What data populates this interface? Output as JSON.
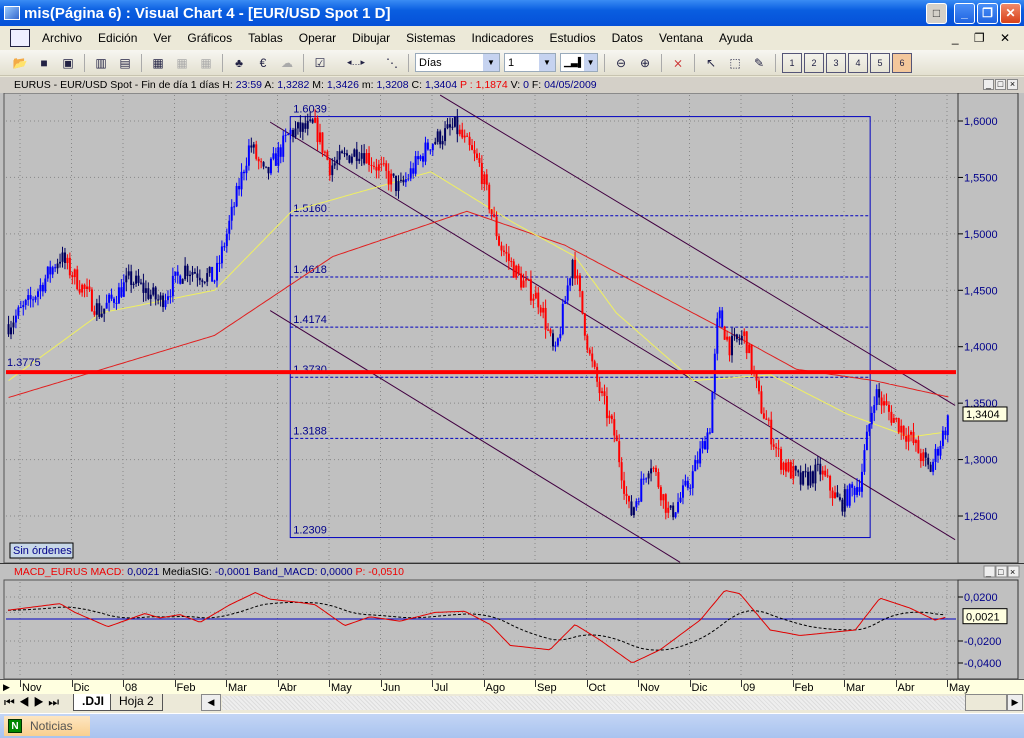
{
  "window": {
    "title": "mis(Página 6) : Visual Chart 4 - [EUR/USD Spot 1 D]"
  },
  "menu": [
    "Archivo",
    "Edición",
    "Ver",
    "Gráficos",
    "Tablas",
    "Operar",
    "Dibujar",
    "Sistemas",
    "Indicadores",
    "Estudios",
    "Datos",
    "Ventana",
    "Ayuda"
  ],
  "toolbar": {
    "period": "Días",
    "compression": "1",
    "page_buttons": [
      "1",
      "2",
      "3",
      "4",
      "5",
      "6"
    ],
    "active_page": "6"
  },
  "info": {
    "symbol": "EURUS - EUR/USD Spot - Fin de día 1 días",
    "H": "23:59",
    "A": "1,3282",
    "M": "1,3426",
    "m": "1,3208",
    "C": "1,3404",
    "P": "1,1874",
    "V": "0",
    "F": "04/05/2009"
  },
  "price_axis": {
    "labels": [
      "1,6000",
      "1,5500",
      "1,5000",
      "1,4500",
      "1,4000",
      "1,3500",
      "1,3000",
      "1,2500"
    ],
    "current": "1,3404"
  },
  "orders_label": "Sin órdenes",
  "macd": {
    "header_name": "MACD_EURUS",
    "macd_label": "MACD:",
    "macd": "0,0021",
    "sig_label": "MediaSIG:",
    "sig": "-0,0001",
    "band_label": "Band_MACD:",
    "band": "0,0000",
    "p_label": "P:",
    "p": "-0,0510",
    "axis": [
      "0,0200",
      "-0,0200",
      "-0,0400"
    ],
    "current": "0,0021"
  },
  "time_axis": [
    "Nov",
    "Dic",
    "08",
    "Feb",
    "Mar",
    "Abr",
    "May",
    "Jun",
    "Jul",
    "Ago",
    "Sep",
    "Oct",
    "Nov",
    "Dic",
    "09",
    "Feb",
    "Mar",
    "Abr",
    "May"
  ],
  "tabs": [
    ".DJI",
    "Hoja 2"
  ],
  "taskbar": {
    "item": "Noticias"
  },
  "colors": {
    "up": "#0000ff",
    "down": "#ff0000",
    "neutral": "#000060",
    "ma_fast": "#f0f060",
    "ma_slow": "#e02020",
    "fib": "#0000c0",
    "channel": "#400040",
    "support": "#ff0000"
  },
  "chart_data": {
    "type": "candlestick",
    "title": "EUR/USD Spot 1 D",
    "ylim": [
      1.21,
      1.63
    ],
    "price_anchors": [
      [
        -0.3,
        1.42
      ],
      [
        0.12,
        1.44
      ],
      [
        0.7,
        1.48
      ],
      [
        1.48,
        1.43
      ],
      [
        2.06,
        1.46
      ],
      [
        2.64,
        1.44
      ],
      [
        3.13,
        1.47
      ],
      [
        3.71,
        1.46
      ],
      [
        4.39,
        1.58
      ],
      [
        4.68,
        1.55
      ],
      [
        5.17,
        1.59
      ],
      [
        5.65,
        1.595
      ],
      [
        5.94,
        1.56
      ],
      [
        6.52,
        1.575
      ],
      [
        7.3,
        1.54
      ],
      [
        7.88,
        1.58
      ],
      [
        8.37,
        1.595
      ],
      [
        8.85,
        1.56
      ],
      [
        9.24,
        1.49
      ],
      [
        9.63,
        1.46
      ],
      [
        10.02,
        1.44
      ],
      [
        10.31,
        1.39
      ],
      [
        10.66,
        1.48
      ],
      [
        10.99,
        1.39
      ],
      [
        11.18,
        1.36
      ],
      [
        11.48,
        1.32
      ],
      [
        11.77,
        1.25
      ],
      [
        12.16,
        1.3
      ],
      [
        12.54,
        1.25
      ],
      [
        12.93,
        1.28
      ],
      [
        13.32,
        1.33
      ],
      [
        13.48,
        1.43
      ],
      [
        13.71,
        1.4
      ],
      [
        14.0,
        1.41
      ],
      [
        14.29,
        1.35
      ],
      [
        14.68,
        1.3
      ],
      [
        15.07,
        1.28
      ],
      [
        15.46,
        1.29
      ],
      [
        15.84,
        1.26
      ],
      [
        16.23,
        1.28
      ],
      [
        16.52,
        1.36
      ],
      [
        16.82,
        1.34
      ],
      [
        17.2,
        1.32
      ],
      [
        17.59,
        1.29
      ],
      [
        17.98,
        1.34
      ]
    ],
    "ma_fast": [
      [
        -0.3,
        1.37
      ],
      [
        1.5,
        1.43
      ],
      [
        3.7,
        1.45
      ],
      [
        5.2,
        1.52
      ],
      [
        7.9,
        1.555
      ],
      [
        9.5,
        1.51
      ],
      [
        10.7,
        1.48
      ],
      [
        11.5,
        1.43
      ],
      [
        13.0,
        1.37
      ],
      [
        14.5,
        1.375
      ],
      [
        16.0,
        1.34
      ],
      [
        17.2,
        1.32
      ],
      [
        18.0,
        1.325
      ]
    ],
    "ma_slow": [
      [
        -0.3,
        1.355
      ],
      [
        3.7,
        1.41
      ],
      [
        6.0,
        1.48
      ],
      [
        8.6,
        1.52
      ],
      [
        10.5,
        1.49
      ],
      [
        13.4,
        1.42
      ],
      [
        15.0,
        1.38
      ],
      [
        16.5,
        1.37
      ],
      [
        18.0,
        1.355
      ]
    ],
    "channel": [
      [
        [
          8.08,
          1.623
        ],
        [
          18.08,
          1.348
        ]
      ],
      [
        [
          4.78,
          1.599
        ],
        [
          18.08,
          1.229
        ]
      ],
      [
        [
          4.78,
          1.432
        ],
        [
          12.74,
          1.209
        ]
      ]
    ],
    "fib": {
      "from": 5.17,
      "to": 16.43,
      "levels": [
        "1.6039",
        "1.5160",
        "1.4618",
        "1.4174",
        "1.3730",
        "1.3188",
        "1.2309"
      ]
    },
    "support": {
      "value": 1.3775,
      "label": "1.3775"
    },
    "macd_series": [
      [
        -0.31,
        0.008
      ],
      [
        0.7,
        0.014
      ],
      [
        0.99,
        0.006
      ],
      [
        1.63,
        -0.007
      ],
      [
        2.35,
        0.005
      ],
      [
        2.64,
        0.001
      ],
      [
        3.03,
        0.004
      ],
      [
        3.42,
        -0.003
      ],
      [
        4.0,
        0.013
      ],
      [
        4.49,
        0.024
      ],
      [
        4.78,
        0.018
      ],
      [
        5.36,
        0.015
      ],
      [
        5.65,
        0.013
      ],
      [
        6.23,
        -0.006
      ],
      [
        6.72,
        0.002
      ],
      [
        7.3,
        -0.002
      ],
      [
        7.98,
        0.006
      ],
      [
        8.56,
        0.007
      ],
      [
        9.05,
        -0.005
      ],
      [
        9.44,
        -0.024
      ],
      [
        10.21,
        -0.028
      ],
      [
        10.7,
        -0.005
      ],
      [
        11.18,
        -0.019
      ],
      [
        11.81,
        -0.04
      ],
      [
        12.35,
        -0.028
      ],
      [
        13.13,
        -0.001
      ],
      [
        13.61,
        0.026
      ],
      [
        13.9,
        0.023
      ],
      [
        14.49,
        -0.01
      ],
      [
        15.07,
        -0.015
      ],
      [
        16.14,
        -0.01
      ],
      [
        16.62,
        0.019
      ],
      [
        17.2,
        0.01
      ],
      [
        17.69,
        -0.001
      ],
      [
        17.94,
        0.0021
      ]
    ],
    "macd_ylim": [
      -0.046,
      0.036
    ]
  }
}
